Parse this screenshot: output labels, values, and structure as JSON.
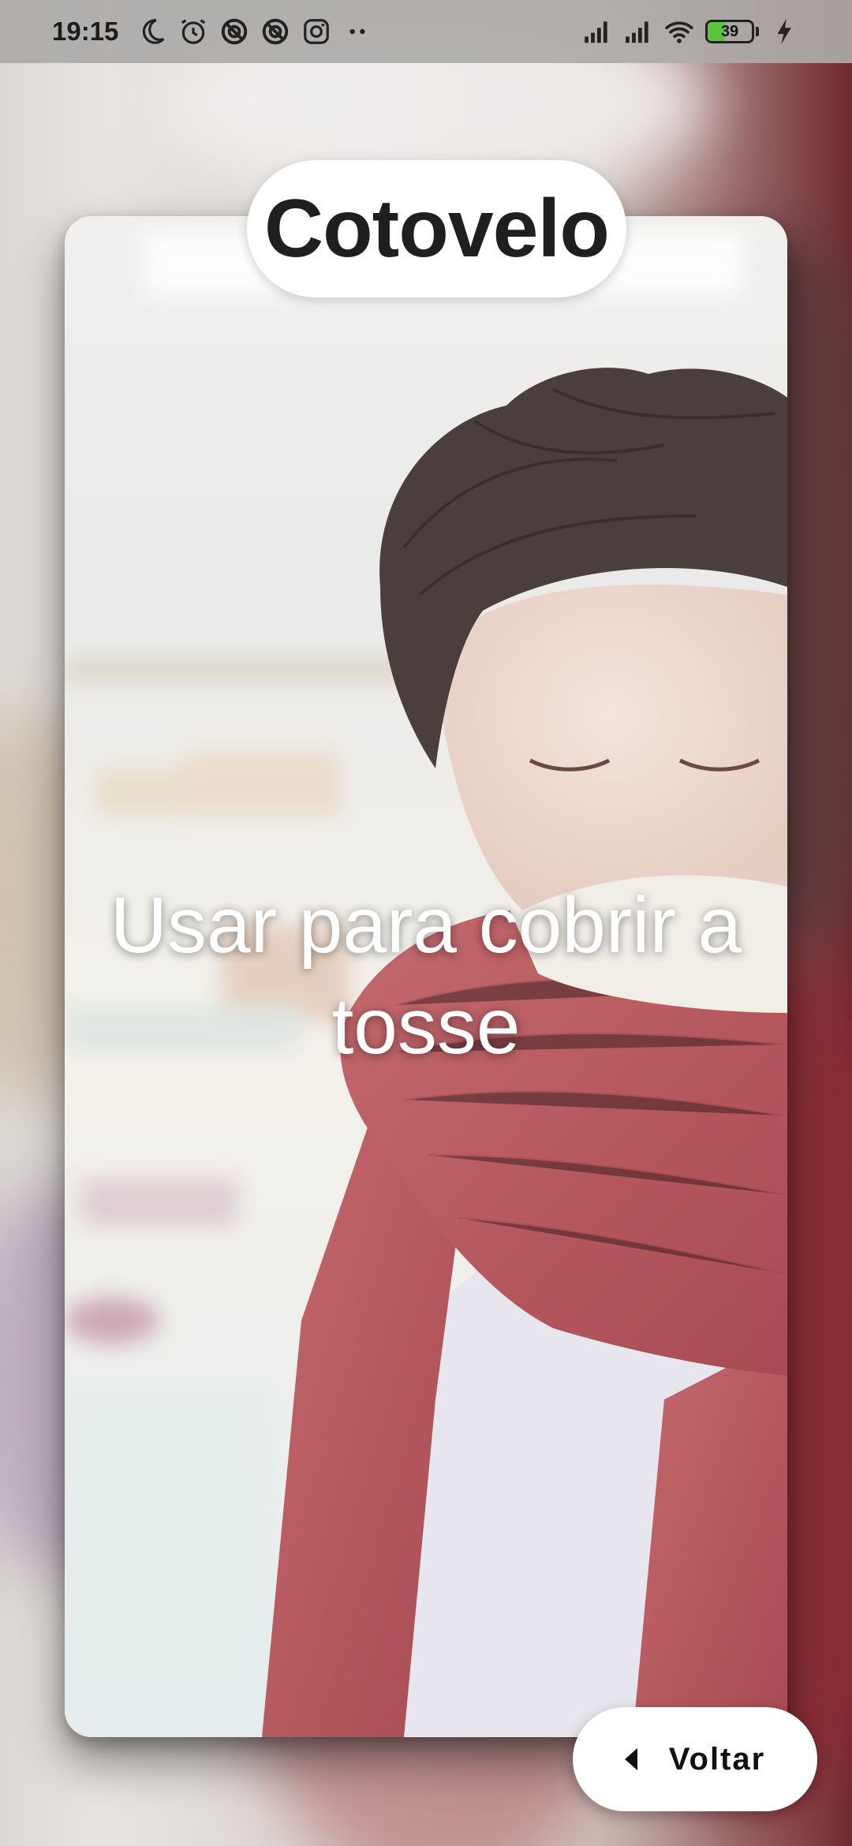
{
  "status_bar": {
    "time": "19:15",
    "battery_level": "39",
    "battery_fraction": 0.39,
    "icons_left": [
      "moon-icon",
      "alarm-icon",
      "blocked-icon",
      "blocked-icon",
      "instagram-icon",
      "more-dots-icon"
    ],
    "icons_right": [
      "signal-icon",
      "signal-icon",
      "wifi-icon",
      "battery-icon",
      "charging-icon"
    ]
  },
  "card": {
    "title": "Cotovelo",
    "caption": "Usar para cobrir a tosse"
  },
  "back_button": {
    "label": "Voltar"
  },
  "colors": {
    "pill_background": "#ffffff",
    "caption_text": "#ffffff",
    "battery_fill": "#5cc43f",
    "sweater": "#b8595d"
  }
}
